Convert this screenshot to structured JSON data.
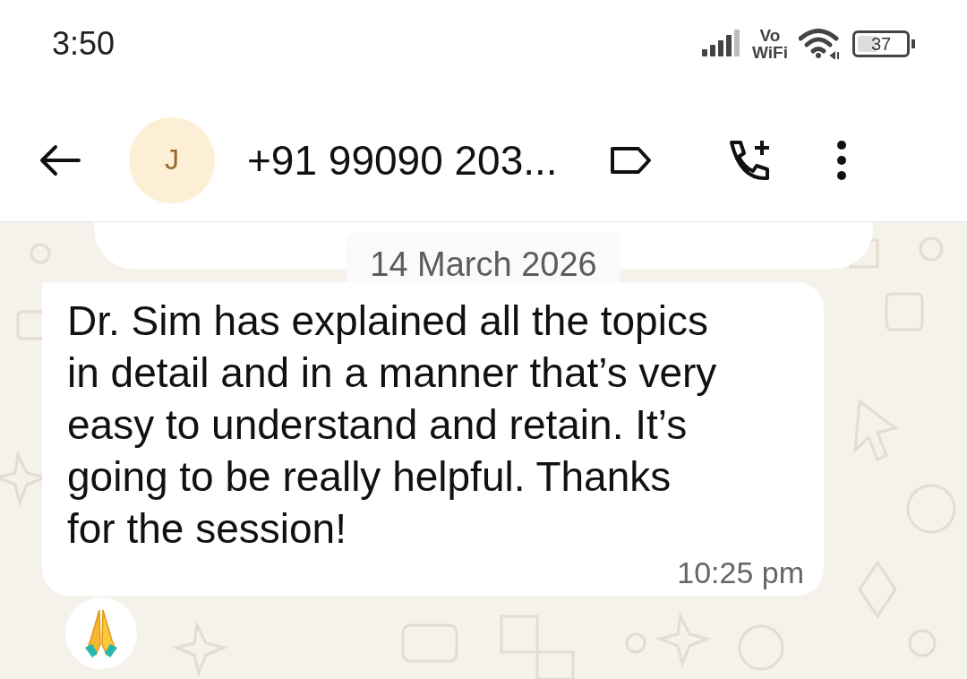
{
  "status_bar": {
    "time": "3:50",
    "network_label_top": "Vo",
    "network_label_bottom": "WiFi",
    "battery": "37"
  },
  "header": {
    "avatar_letter": "J",
    "contact": "+91 99090 203..."
  },
  "date_chip": "14 March 2026",
  "message": {
    "text_lines": [
      "Dr. Sim has explained all the topics",
      "in detail and in a manner that’s very",
      "easy to understand and retain. It’s",
      "going to be really helpful. Thanks",
      "for the session!"
    ],
    "time": "10:25 pm",
    "reaction": {
      "kind": "praying-hands"
    }
  }
}
